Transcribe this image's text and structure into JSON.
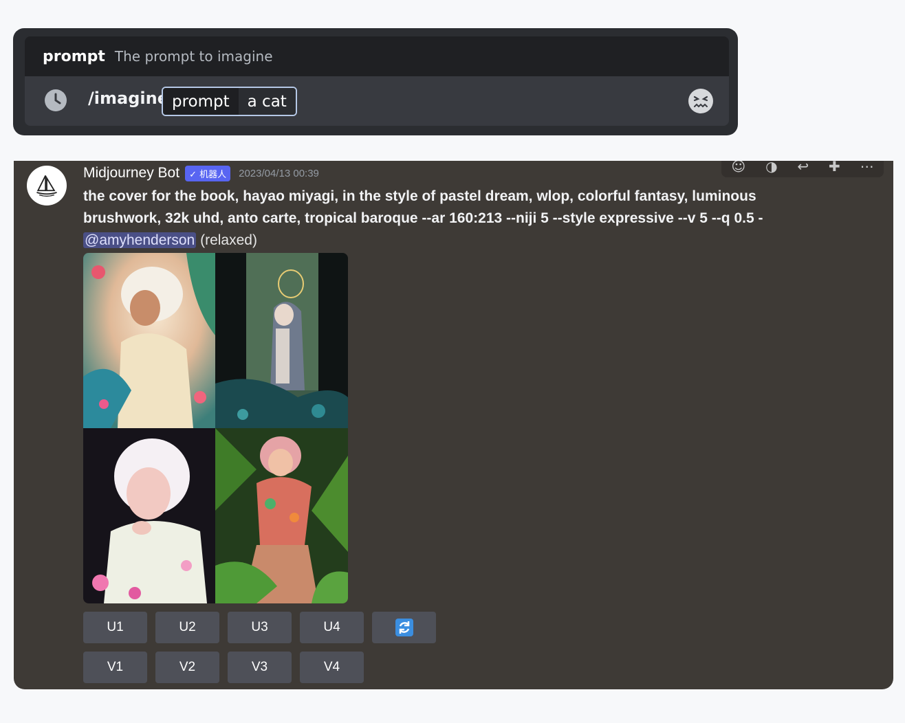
{
  "command_panel": {
    "hint": {
      "option_name": "prompt",
      "option_description": "The prompt to imagine"
    },
    "command": "/imagine",
    "option_pill": {
      "name": "prompt",
      "value": "a cat"
    },
    "icons": {
      "history": "clock-icon",
      "emoji": "emoji-picker-icon"
    }
  },
  "message": {
    "author": "Midjourney Bot",
    "bot_badge": "✓ 机器人",
    "timestamp": "2023/04/13 00:39",
    "prompt_text": "the cover for the book, hayao miyagi, in the style of pastel dream, wlop, colorful fantasy, luminous brushwork, 32k uhd, anto carte, tropical baroque --ar 160:213 --niji 5 --style expressive --v 5 --q 0.5 -",
    "mention": "@amyhenderson",
    "status": "(relaxed)",
    "toolbar_icons": [
      "add-reaction-icon",
      "app-icon",
      "reply-icon",
      "create-thread-icon",
      "more-icon"
    ],
    "upscale_buttons": [
      "U1",
      "U2",
      "U3",
      "U4"
    ],
    "variation_buttons": [
      "V1",
      "V2",
      "V3",
      "V4"
    ],
    "reroll_icon": "reroll-icon",
    "colors": {
      "accent": "#5865f2",
      "reroll": "#3b8ee0",
      "card_bg": "#3e3a36"
    }
  }
}
